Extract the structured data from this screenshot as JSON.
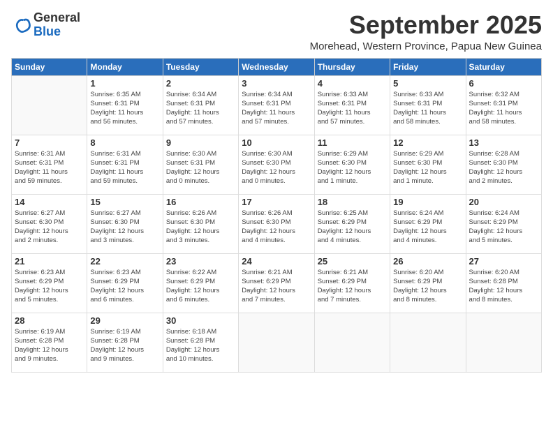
{
  "logo": {
    "general": "General",
    "blue": "Blue"
  },
  "title": "September 2025",
  "subtitle": "Morehead, Western Province, Papua New Guinea",
  "days_of_week": [
    "Sunday",
    "Monday",
    "Tuesday",
    "Wednesday",
    "Thursday",
    "Friday",
    "Saturday"
  ],
  "weeks": [
    [
      {
        "day": "",
        "info": ""
      },
      {
        "day": "1",
        "info": "Sunrise: 6:35 AM\nSunset: 6:31 PM\nDaylight: 11 hours\nand 56 minutes."
      },
      {
        "day": "2",
        "info": "Sunrise: 6:34 AM\nSunset: 6:31 PM\nDaylight: 11 hours\nand 57 minutes."
      },
      {
        "day": "3",
        "info": "Sunrise: 6:34 AM\nSunset: 6:31 PM\nDaylight: 11 hours\nand 57 minutes."
      },
      {
        "day": "4",
        "info": "Sunrise: 6:33 AM\nSunset: 6:31 PM\nDaylight: 11 hours\nand 57 minutes."
      },
      {
        "day": "5",
        "info": "Sunrise: 6:33 AM\nSunset: 6:31 PM\nDaylight: 11 hours\nand 58 minutes."
      },
      {
        "day": "6",
        "info": "Sunrise: 6:32 AM\nSunset: 6:31 PM\nDaylight: 11 hours\nand 58 minutes."
      }
    ],
    [
      {
        "day": "7",
        "info": "Sunrise: 6:31 AM\nSunset: 6:31 PM\nDaylight: 11 hours\nand 59 minutes."
      },
      {
        "day": "8",
        "info": "Sunrise: 6:31 AM\nSunset: 6:31 PM\nDaylight: 11 hours\nand 59 minutes."
      },
      {
        "day": "9",
        "info": "Sunrise: 6:30 AM\nSunset: 6:31 PM\nDaylight: 12 hours\nand 0 minutes."
      },
      {
        "day": "10",
        "info": "Sunrise: 6:30 AM\nSunset: 6:30 PM\nDaylight: 12 hours\nand 0 minutes."
      },
      {
        "day": "11",
        "info": "Sunrise: 6:29 AM\nSunset: 6:30 PM\nDaylight: 12 hours\nand 1 minute."
      },
      {
        "day": "12",
        "info": "Sunrise: 6:29 AM\nSunset: 6:30 PM\nDaylight: 12 hours\nand 1 minute."
      },
      {
        "day": "13",
        "info": "Sunrise: 6:28 AM\nSunset: 6:30 PM\nDaylight: 12 hours\nand 2 minutes."
      }
    ],
    [
      {
        "day": "14",
        "info": "Sunrise: 6:27 AM\nSunset: 6:30 PM\nDaylight: 12 hours\nand 2 minutes."
      },
      {
        "day": "15",
        "info": "Sunrise: 6:27 AM\nSunset: 6:30 PM\nDaylight: 12 hours\nand 3 minutes."
      },
      {
        "day": "16",
        "info": "Sunrise: 6:26 AM\nSunset: 6:30 PM\nDaylight: 12 hours\nand 3 minutes."
      },
      {
        "day": "17",
        "info": "Sunrise: 6:26 AM\nSunset: 6:30 PM\nDaylight: 12 hours\nand 4 minutes."
      },
      {
        "day": "18",
        "info": "Sunrise: 6:25 AM\nSunset: 6:29 PM\nDaylight: 12 hours\nand 4 minutes."
      },
      {
        "day": "19",
        "info": "Sunrise: 6:24 AM\nSunset: 6:29 PM\nDaylight: 12 hours\nand 4 minutes."
      },
      {
        "day": "20",
        "info": "Sunrise: 6:24 AM\nSunset: 6:29 PM\nDaylight: 12 hours\nand 5 minutes."
      }
    ],
    [
      {
        "day": "21",
        "info": "Sunrise: 6:23 AM\nSunset: 6:29 PM\nDaylight: 12 hours\nand 5 minutes."
      },
      {
        "day": "22",
        "info": "Sunrise: 6:23 AM\nSunset: 6:29 PM\nDaylight: 12 hours\nand 6 minutes."
      },
      {
        "day": "23",
        "info": "Sunrise: 6:22 AM\nSunset: 6:29 PM\nDaylight: 12 hours\nand 6 minutes."
      },
      {
        "day": "24",
        "info": "Sunrise: 6:21 AM\nSunset: 6:29 PM\nDaylight: 12 hours\nand 7 minutes."
      },
      {
        "day": "25",
        "info": "Sunrise: 6:21 AM\nSunset: 6:29 PM\nDaylight: 12 hours\nand 7 minutes."
      },
      {
        "day": "26",
        "info": "Sunrise: 6:20 AM\nSunset: 6:29 PM\nDaylight: 12 hours\nand 8 minutes."
      },
      {
        "day": "27",
        "info": "Sunrise: 6:20 AM\nSunset: 6:28 PM\nDaylight: 12 hours\nand 8 minutes."
      }
    ],
    [
      {
        "day": "28",
        "info": "Sunrise: 6:19 AM\nSunset: 6:28 PM\nDaylight: 12 hours\nand 9 minutes."
      },
      {
        "day": "29",
        "info": "Sunrise: 6:19 AM\nSunset: 6:28 PM\nDaylight: 12 hours\nand 9 minutes."
      },
      {
        "day": "30",
        "info": "Sunrise: 6:18 AM\nSunset: 6:28 PM\nDaylight: 12 hours\nand 10 minutes."
      },
      {
        "day": "",
        "info": ""
      },
      {
        "day": "",
        "info": ""
      },
      {
        "day": "",
        "info": ""
      },
      {
        "day": "",
        "info": ""
      }
    ]
  ]
}
